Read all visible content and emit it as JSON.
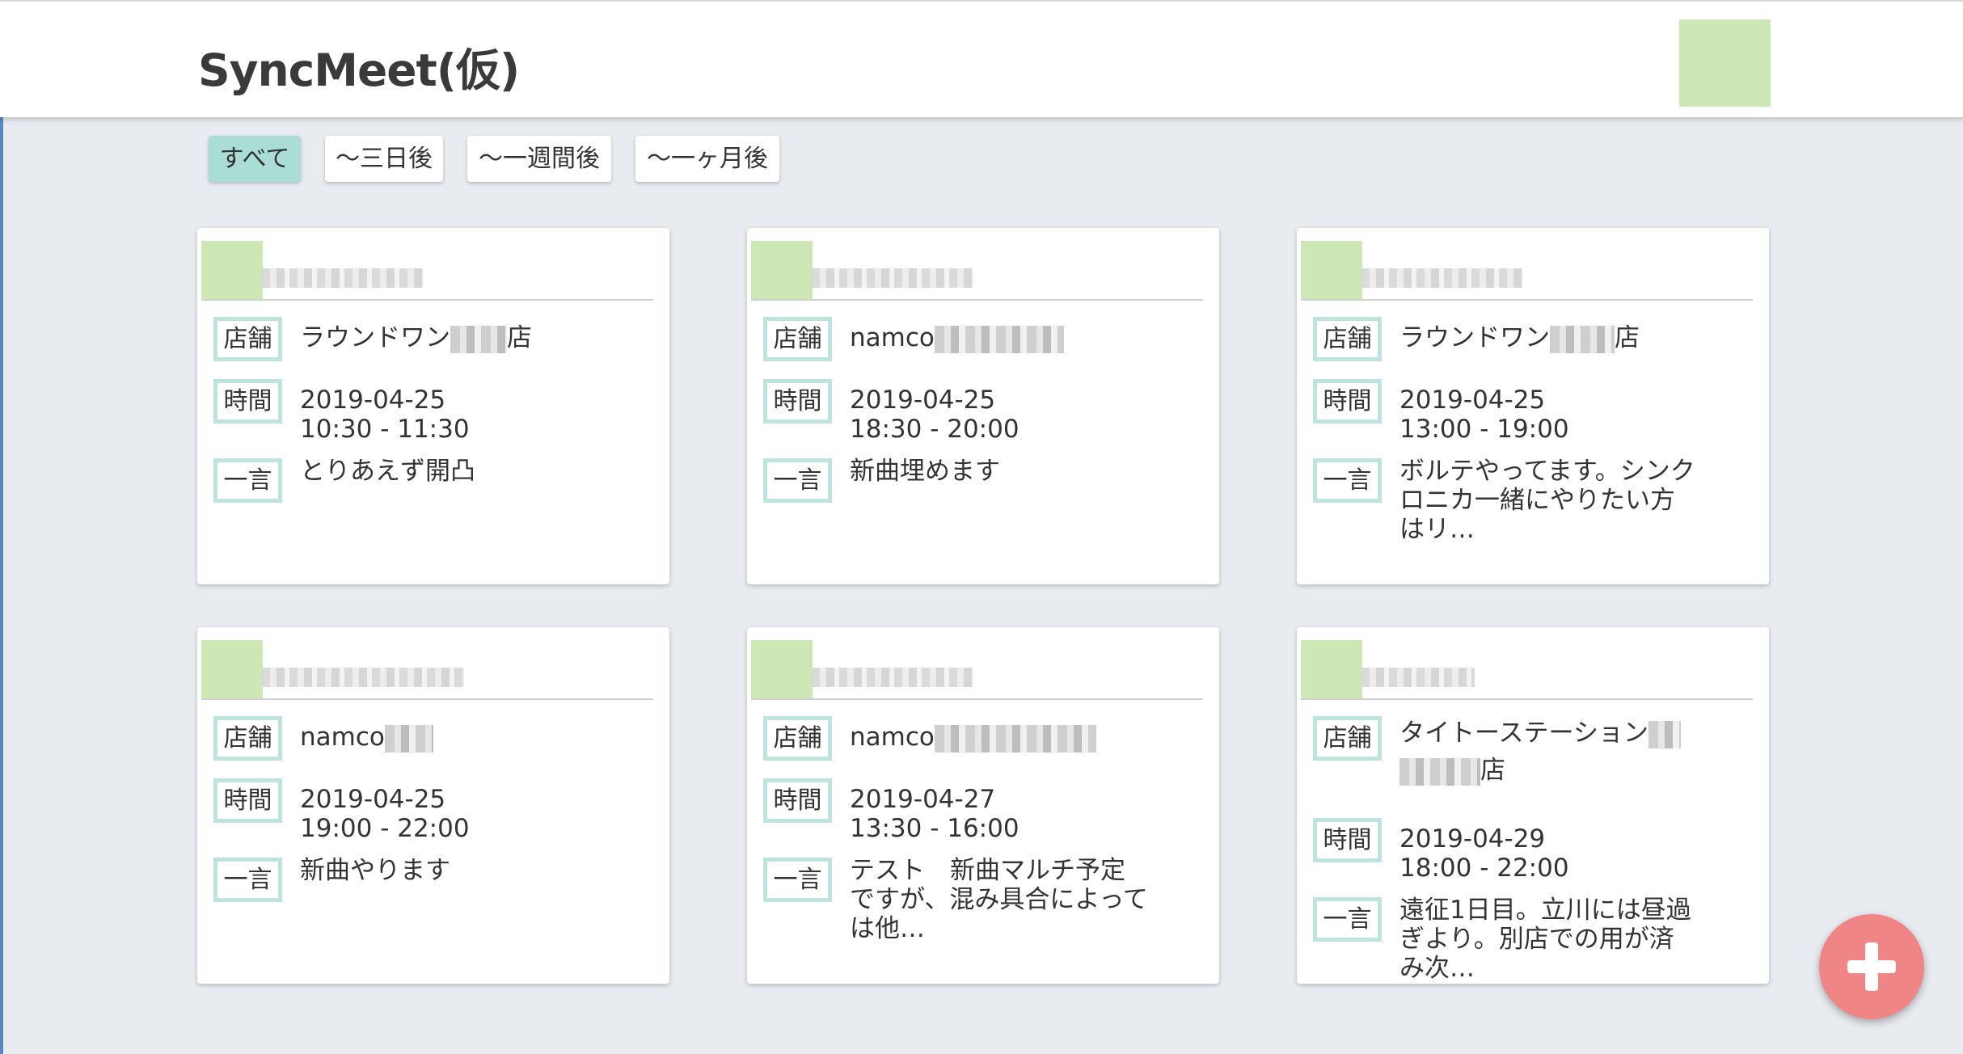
{
  "app": {
    "title": "SyncMeet(仮)"
  },
  "filters": [
    {
      "label": "すべて",
      "active": true
    },
    {
      "label": "〜三日後",
      "active": false
    },
    {
      "label": "〜一週間後",
      "active": false
    },
    {
      "label": "〜一ヶ月後",
      "active": false
    }
  ],
  "labels": {
    "store": "店舗",
    "time": "時間",
    "comment": "一言"
  },
  "cards": [
    {
      "store": "ラウンドワン",
      "store_suffix": "店",
      "date": "2019-04-25",
      "time_range": "10:30 - 11:30",
      "comment": "とりあえず開凸"
    },
    {
      "store": "namco",
      "store_suffix": "",
      "date": "2019-04-25",
      "time_range": "18:30 - 20:00",
      "comment": "新曲埋めます"
    },
    {
      "store": "ラウンドワン",
      "store_suffix": "店",
      "date": "2019-04-25",
      "time_range": "13:00 - 19:00",
      "comment": "ボルテやってます。シンクロニカ一緒にやりたい方はリ…"
    },
    {
      "store": "namco",
      "store_suffix": "",
      "date": "2019-04-25",
      "time_range": "19:00 - 22:00",
      "comment": "新曲やります"
    },
    {
      "store": "namco",
      "store_suffix": "",
      "date": "2019-04-27",
      "time_range": "13:30 - 16:00",
      "comment": "テスト　新曲マルチ予定ですが、混み具合によっては他…"
    },
    {
      "store": "タイトーステーション",
      "store_suffix": "店",
      "date": "2019-04-29",
      "time_range": "18:00 - 22:00",
      "comment": "遠征1日目。立川には昼過ぎより。別店での用が済み次…"
    }
  ],
  "colors": {
    "accent": "#a9ddd5",
    "label_border": "#bfe3df",
    "avatar": "#cde8b4",
    "fab": "#f08585"
  },
  "fab": {
    "icon": "plus-icon"
  }
}
